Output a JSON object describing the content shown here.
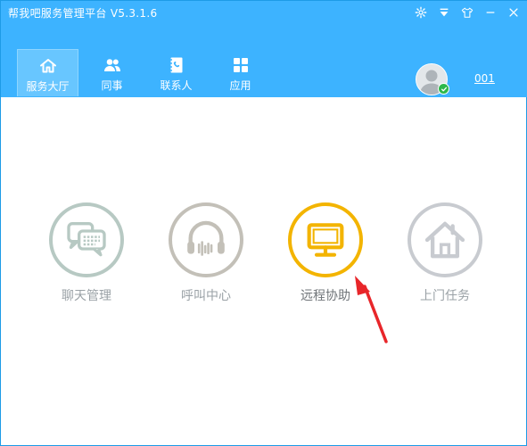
{
  "window": {
    "title": "帮我吧服务管理平台  V5.3.1.6"
  },
  "nav": {
    "tabs": [
      {
        "label": "服务大厅",
        "icon": "home-icon",
        "active": true
      },
      {
        "label": "同事",
        "icon": "colleagues-icon",
        "active": false
      },
      {
        "label": "联系人",
        "icon": "contacts-icon",
        "active": false
      },
      {
        "label": "应用",
        "icon": "apps-icon",
        "active": false
      }
    ]
  },
  "user": {
    "name": "001",
    "status": "online"
  },
  "features": [
    {
      "label": "聊天管理",
      "icon": "chat-icon",
      "color": "#b7c9c3"
    },
    {
      "label": "呼叫中心",
      "icon": "headset-icon",
      "color": "#c3c0b8"
    },
    {
      "label": "远程协助",
      "icon": "monitor-icon",
      "color": "#f3b400"
    },
    {
      "label": "上门任务",
      "icon": "house-icon",
      "color": "#c8cbd0"
    }
  ],
  "colors": {
    "header": "#3db3ff",
    "accent": "#f3b400",
    "arrow": "#e8262a"
  }
}
